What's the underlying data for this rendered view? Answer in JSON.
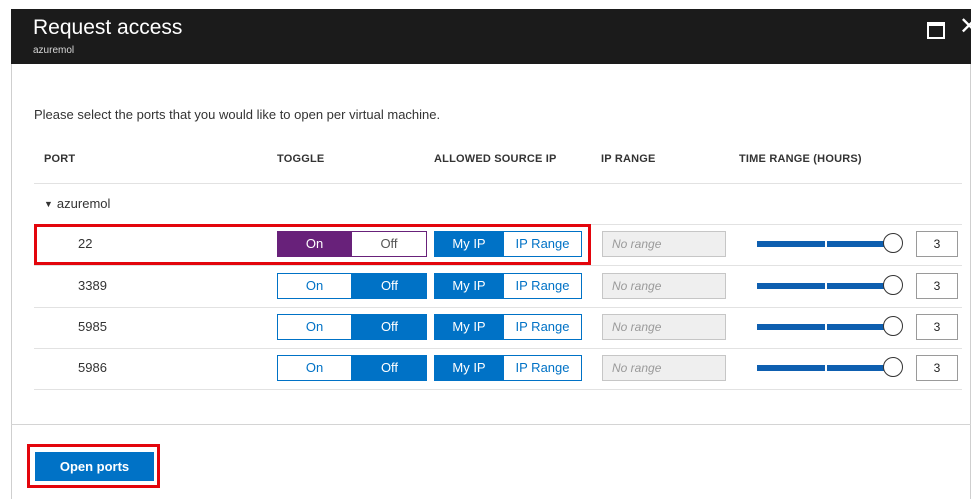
{
  "window": {
    "title": "Request access",
    "subtitle": "azuremol",
    "maximize_icon": "maximize-icon",
    "close_icon": "close-icon",
    "close_glyph": "✕"
  },
  "intro_text": "Please select the ports that you would like to open per virtual machine.",
  "columns": {
    "port": "PORT",
    "toggle": "TOGGLE",
    "allowed_source_ip": "ALLOWED SOURCE IP",
    "ip_range": "IP RANGE",
    "time_range": "TIME RANGE (HOURS)"
  },
  "group": {
    "name": "azuremol",
    "caret": "▼",
    "expanded": true
  },
  "toggle_labels": {
    "on": "On",
    "off": "Off"
  },
  "source_ip_labels": {
    "my_ip": "My IP",
    "ip_range": "IP Range"
  },
  "rows": [
    {
      "port": "22",
      "toggle": "On",
      "source_ip": "My IP",
      "ip_range_placeholder": "No range",
      "hours": "3",
      "highlighted": true
    },
    {
      "port": "3389",
      "toggle": "Off",
      "source_ip": "My IP",
      "ip_range_placeholder": "No range",
      "hours": "3",
      "highlighted": false
    },
    {
      "port": "5985",
      "toggle": "Off",
      "source_ip": "My IP",
      "ip_range_placeholder": "No range",
      "hours": "3",
      "highlighted": false
    },
    {
      "port": "5986",
      "toggle": "Off",
      "source_ip": "My IP",
      "ip_range_placeholder": "No range",
      "hours": "3",
      "highlighted": false
    }
  ],
  "footer": {
    "open_ports_label": "Open ports"
  },
  "colors": {
    "titlebar": "#1b1b1b",
    "accent_blue": "#0072c6",
    "toggle_on_purple": "#68217a",
    "highlight_red": "#e3050c"
  }
}
